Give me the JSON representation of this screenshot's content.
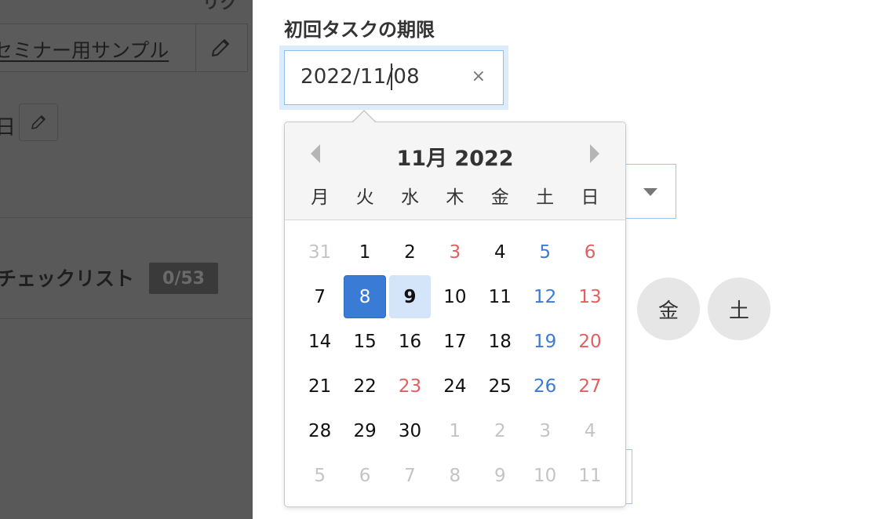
{
  "background": {
    "top_partial_text": "リク",
    "title": "セミナー用サンプル",
    "small_label": "日",
    "checklist_label": "チェックリスト",
    "checklist_count": "0/53"
  },
  "field": {
    "label": "初回タスクの期限",
    "value": "2022/11/08",
    "clear_symbol": "×"
  },
  "weekday_buttons": [
    {
      "label": "金"
    },
    {
      "label": "土"
    }
  ],
  "datepicker": {
    "title": "11月 2022",
    "weekdays": [
      "月",
      "火",
      "水",
      "木",
      "金",
      "土",
      "日"
    ],
    "weeks": [
      [
        {
          "d": "31",
          "s": "muted"
        },
        {
          "d": "1",
          "s": ""
        },
        {
          "d": "2",
          "s": ""
        },
        {
          "d": "3",
          "s": "holiday"
        },
        {
          "d": "4",
          "s": ""
        },
        {
          "d": "5",
          "s": "sat"
        },
        {
          "d": "6",
          "s": "sun"
        }
      ],
      [
        {
          "d": "7",
          "s": ""
        },
        {
          "d": "8",
          "s": "selected"
        },
        {
          "d": "9",
          "s": "today"
        },
        {
          "d": "10",
          "s": ""
        },
        {
          "d": "11",
          "s": ""
        },
        {
          "d": "12",
          "s": "sat"
        },
        {
          "d": "13",
          "s": "sun"
        }
      ],
      [
        {
          "d": "14",
          "s": ""
        },
        {
          "d": "15",
          "s": ""
        },
        {
          "d": "16",
          "s": ""
        },
        {
          "d": "17",
          "s": ""
        },
        {
          "d": "18",
          "s": ""
        },
        {
          "d": "19",
          "s": "sat"
        },
        {
          "d": "20",
          "s": "sun"
        }
      ],
      [
        {
          "d": "21",
          "s": ""
        },
        {
          "d": "22",
          "s": ""
        },
        {
          "d": "23",
          "s": "holiday"
        },
        {
          "d": "24",
          "s": ""
        },
        {
          "d": "25",
          "s": ""
        },
        {
          "d": "26",
          "s": "sat"
        },
        {
          "d": "27",
          "s": "sun"
        }
      ],
      [
        {
          "d": "28",
          "s": ""
        },
        {
          "d": "29",
          "s": ""
        },
        {
          "d": "30",
          "s": ""
        },
        {
          "d": "1",
          "s": "muted"
        },
        {
          "d": "2",
          "s": "muted"
        },
        {
          "d": "3",
          "s": "muted"
        },
        {
          "d": "4",
          "s": "muted"
        }
      ],
      [
        {
          "d": "5",
          "s": "muted"
        },
        {
          "d": "6",
          "s": "muted"
        },
        {
          "d": "7",
          "s": "muted"
        },
        {
          "d": "8",
          "s": "muted"
        },
        {
          "d": "9",
          "s": "muted"
        },
        {
          "d": "10",
          "s": "muted"
        },
        {
          "d": "11",
          "s": "muted"
        }
      ]
    ],
    "colors": {
      "selected": "#3a7bd5",
      "today": "#d4e5f9",
      "saturday": "#3a7bd5",
      "sunday_holiday": "#e06060",
      "muted": "#c4c4c4"
    }
  }
}
